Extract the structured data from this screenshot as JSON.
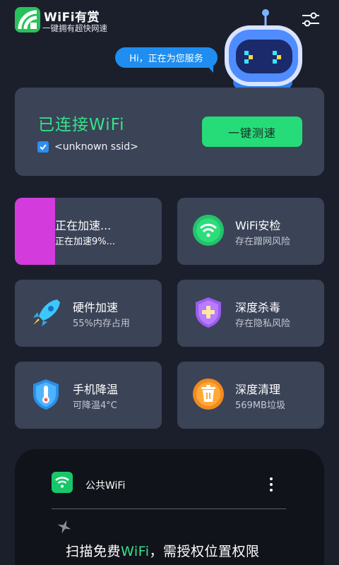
{
  "header": {
    "app_name": "WiFi有赏",
    "tagline": "一键拥有超快网速",
    "settings_icon": "sliders-icon"
  },
  "assistant": {
    "greeting": "Hi，正在为您服务"
  },
  "connection": {
    "status": "已连接WiFi",
    "ssid": "<unknown ssid>",
    "speed_button": "一键测速"
  },
  "features": {
    "accel": {
      "title": "正在加速...",
      "subtitle": "正在加速9%...",
      "progress_percent": 9
    },
    "wifi_check": {
      "title": "WiFi安检",
      "subtitle": "存在蹭网风险",
      "icon": "wifi-shield-icon"
    },
    "hardware": {
      "title": "硬件加速",
      "subtitle": "55%内存占用",
      "icon": "rocket-icon"
    },
    "antivirus": {
      "title": "深度杀毒",
      "subtitle": "存在隐私风险",
      "icon": "shield-plus-icon"
    },
    "cooling": {
      "title": "手机降温",
      "subtitle": "可降温4°C",
      "icon": "thermometer-shield-icon"
    },
    "cleaning": {
      "title": "深度清理",
      "subtitle": "569MB垃圾",
      "icon": "trash-icon"
    }
  },
  "bottom": {
    "wifi_label": "公共WiFi",
    "scan_prefix": "扫描免费",
    "scan_highlight": "WiFi",
    "scan_suffix": "，需授权位置权限"
  },
  "colors": {
    "background": "#1b1f2c",
    "card": "#3b4357",
    "accent_green": "#35e389",
    "button_green": "#26dc78",
    "progress_magenta": "#d33bdd",
    "bubble_blue": "#1f8ef0"
  }
}
